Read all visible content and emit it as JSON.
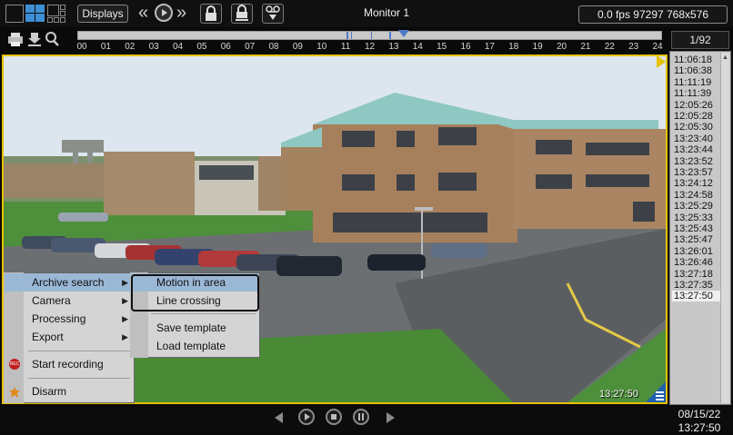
{
  "topbar": {
    "displays_label": "Displays",
    "monitor_title": "Monitor 1",
    "fps_text": "0.0 fps  97297 768x576"
  },
  "timeline": {
    "ticks": [
      "00",
      "01",
      "02",
      "03",
      "04",
      "05",
      "06",
      "07",
      "08",
      "09",
      "10",
      "11",
      "12",
      "13",
      "14",
      "15",
      "16",
      "17",
      "18",
      "19",
      "20",
      "21",
      "22",
      "23",
      "24"
    ]
  },
  "counter": "1/92",
  "video": {
    "timestamp": "13:27:50"
  },
  "timelist": {
    "items": [
      "11:06:18",
      "11:06:38",
      "11:11:19",
      "11:11:39",
      "12:05:26",
      "12:05:28",
      "12:05:30",
      "13:23:40",
      "13:23:44",
      "13:23:52",
      "13:23:57",
      "13:24:12",
      "13:24:58",
      "13:25:29",
      "13:25:33",
      "13:25:43",
      "13:25:47",
      "13:26:01",
      "13:26:46",
      "13:27:18",
      "13:27:35",
      "13:27:50"
    ],
    "selected_index": 21
  },
  "menu": {
    "archive_search": "Archive search",
    "camera": "Camera",
    "processing": "Processing",
    "export": "Export",
    "start_recording": "Start recording",
    "disarm": "Disarm",
    "rec_icon_text": "REC"
  },
  "submenu": {
    "motion": "Motion in area",
    "line": "Line crossing",
    "save": "Save template",
    "load": "Load template"
  },
  "bottom": {
    "date": "08/15/22",
    "time": "13:27:50"
  },
  "colors": {
    "video_border": "#e5c100",
    "highlight": "#9ab8d6",
    "timeline_marker": "#4d79c7"
  }
}
